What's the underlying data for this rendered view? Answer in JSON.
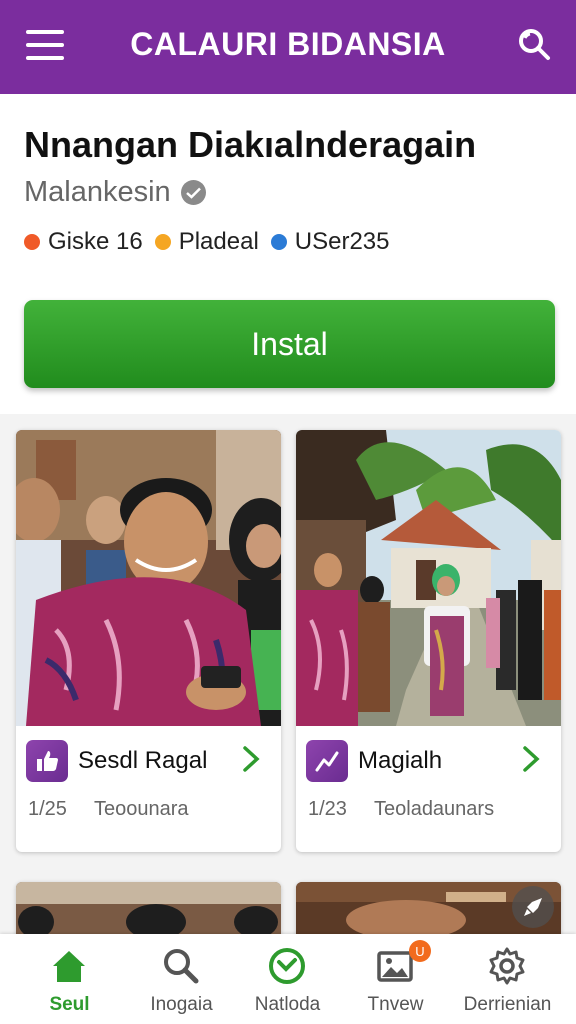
{
  "header": {
    "title": "CALAURI BIDANSIA",
    "menu_icon": "hamburger-menu-icon",
    "search_icon": "search-icon",
    "background": "#7b2d9e"
  },
  "app": {
    "title": "Nnangan Diakıalnderagain",
    "developer": "Malankesin",
    "meta": [
      {
        "label": "Giske 16",
        "color": "#f05a28"
      },
      {
        "label": "Pladeal",
        "color": "#f5a623"
      },
      {
        "label": "USer235",
        "color": "#2b7bd6"
      }
    ],
    "install_label": "Instal",
    "install_color": "#2e9b2e"
  },
  "cards": [
    {
      "title": "Sesdl Ragal",
      "count": "1/25",
      "subtitle": "Teoounara",
      "icon": "thumbs-up-icon"
    },
    {
      "title": "Magialh",
      "count": "1/23",
      "subtitle": "Teoladaunars",
      "icon": "trend-line-icon"
    }
  ],
  "nav": [
    {
      "label": "Seul",
      "icon": "home-icon",
      "active": true
    },
    {
      "label": "Inogaia",
      "icon": "search-icon",
      "active": false
    },
    {
      "label": "Natloda",
      "icon": "check-circle-icon",
      "active": false
    },
    {
      "label": "Tnvew",
      "icon": "image-icon",
      "active": false,
      "badge": "U"
    },
    {
      "label": "Derrienian",
      "icon": "gear-icon",
      "active": false
    }
  ]
}
